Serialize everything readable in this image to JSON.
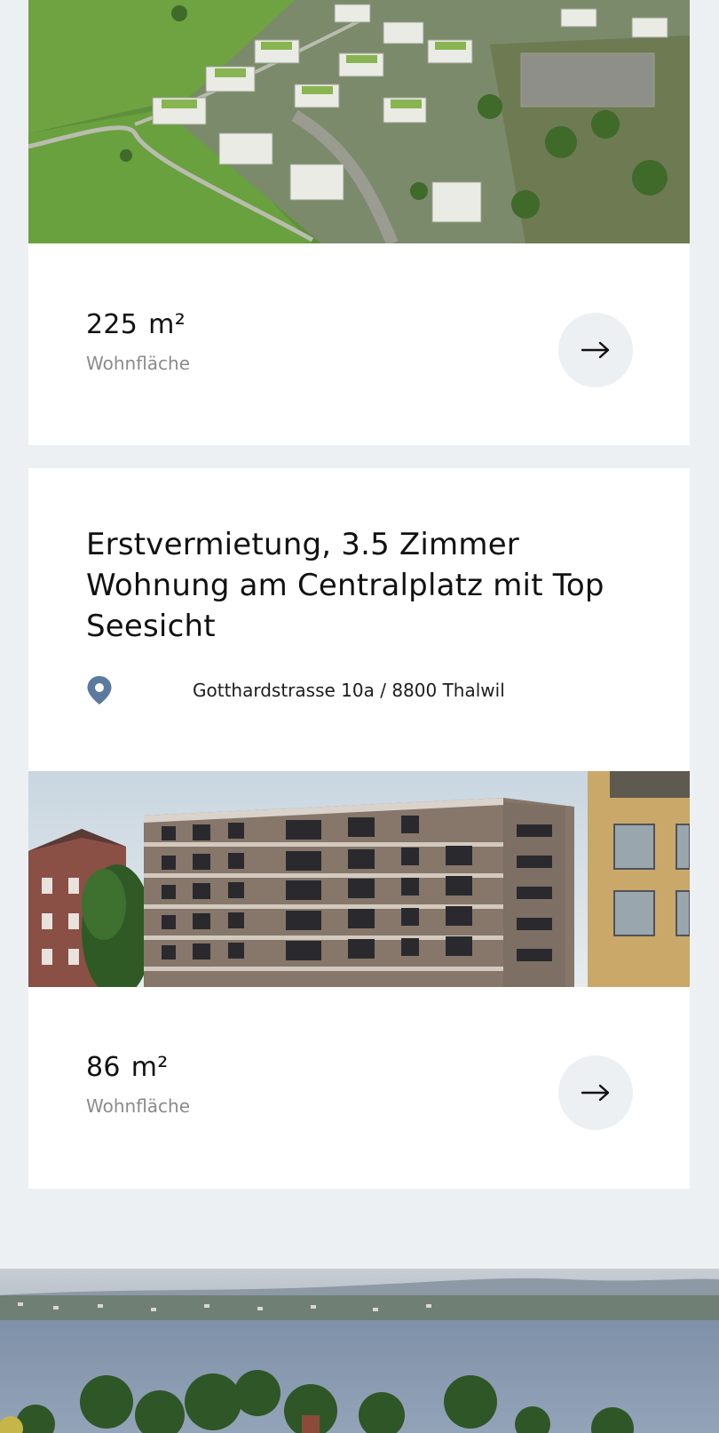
{
  "listings": [
    {
      "photo_alt": "",
      "area_value": "225",
      "area_unit": "m²",
      "area_label": "Wohnfläche",
      "action_icon": "arrow-right-icon"
    },
    {
      "title": "Erstvermietung, 3.5 Zimmer Wohnung am Centralplatz mit Top Seesicht",
      "address": "Gotthardstrasse 10a / 8800 Thalwil",
      "address_icon": "location-pin-icon",
      "area_value": "86",
      "area_unit": "m²",
      "area_label": "Wohnfläche",
      "action_icon": "arrow-right-icon"
    }
  ],
  "colors": {
    "page_background": "#edf0f3",
    "card_background": "#ffffff",
    "pin_color": "#5b7a9d",
    "muted_text": "#8b8b8b"
  }
}
